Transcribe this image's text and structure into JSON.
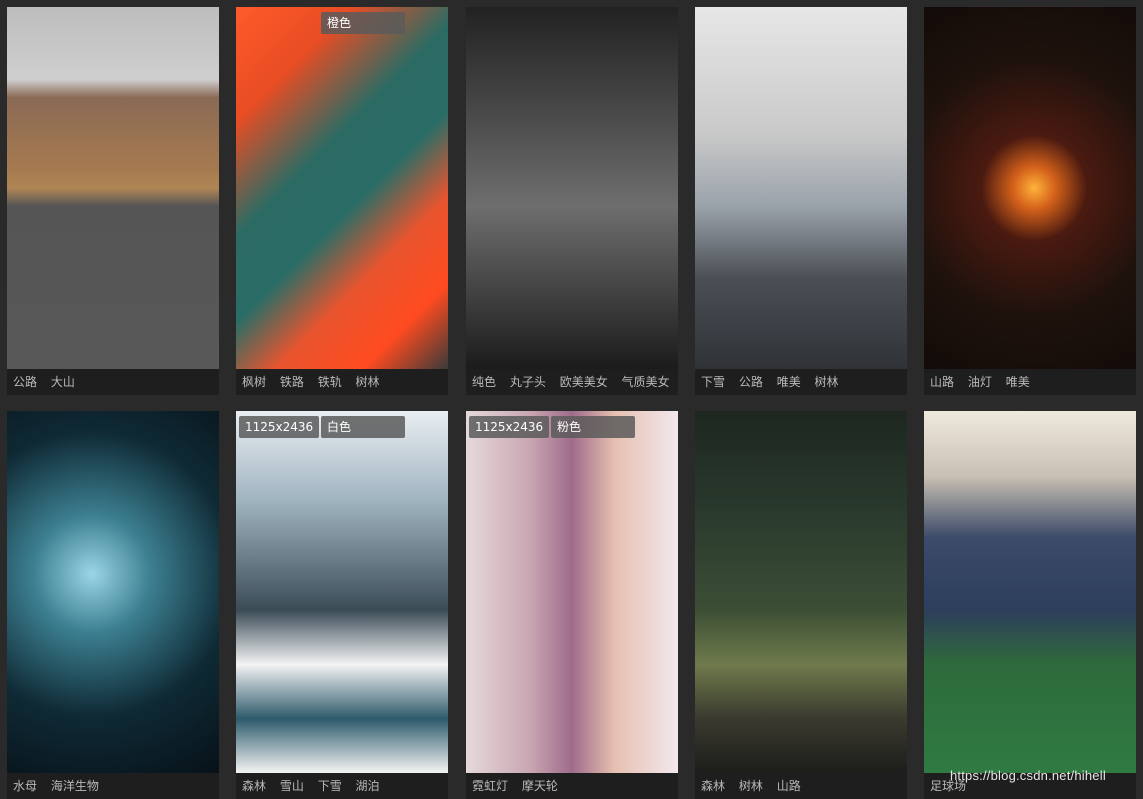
{
  "cards": [
    {
      "tags": [
        "公路",
        "大山"
      ]
    },
    {
      "tags": [
        "枫树",
        "铁路",
        "铁轨",
        "树林"
      ],
      "color_label": "橙色"
    },
    {
      "tags": [
        "纯色",
        "丸子头",
        "欧美美女",
        "气质美女"
      ]
    },
    {
      "tags": [
        "下雪",
        "公路",
        "唯美",
        "树林"
      ]
    },
    {
      "tags": [
        "山路",
        "油灯",
        "唯美"
      ]
    },
    {
      "tags": [
        "水母",
        "海洋生物"
      ]
    },
    {
      "tags": [
        "森林",
        "雪山",
        "下雪",
        "湖泊"
      ],
      "resolution": "1125x2436",
      "color_label": "白色"
    },
    {
      "tags": [
        "霓虹灯",
        "摩天轮"
      ],
      "resolution": "1125x2436",
      "color_label": "粉色"
    },
    {
      "tags": [
        "森林",
        "树林",
        "山路"
      ]
    },
    {
      "tags": [
        "足球场"
      ]
    }
  ],
  "watermark": "https://blog.csdn.net/hihell"
}
